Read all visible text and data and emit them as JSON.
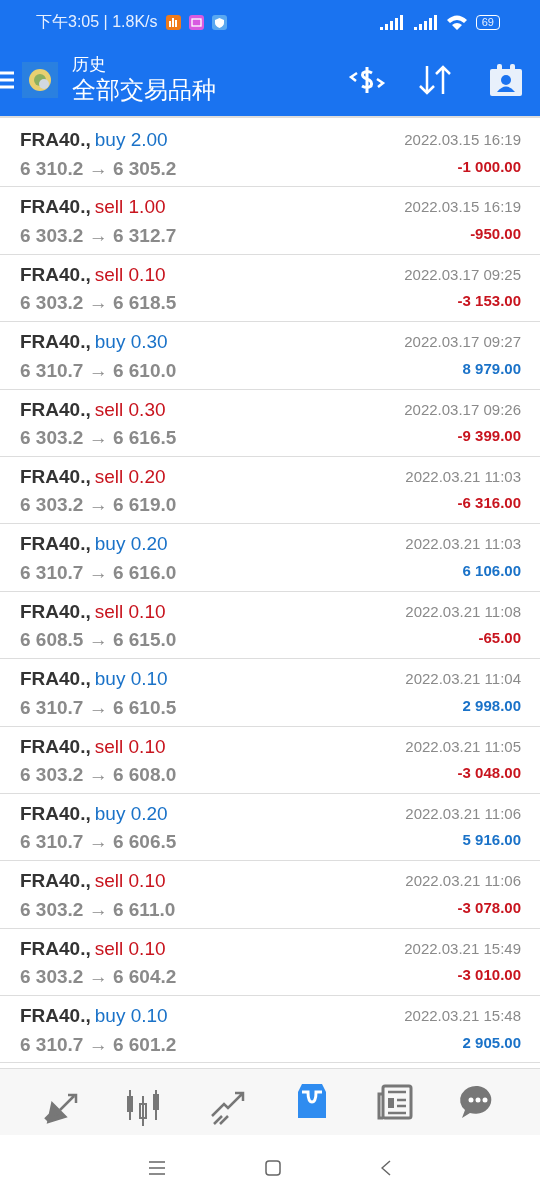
{
  "status_bar": {
    "time_speed": "下午3:05 | 1.8K/s",
    "battery": "69"
  },
  "header": {
    "subtitle": "历史",
    "title": "全部交易品种"
  },
  "trades": [
    {
      "symbol": "FRA40.,",
      "trade": "buy 2.00",
      "kind": "buy",
      "prices": "6 310.2 → 6 305.2",
      "time": "2022.03.15 16:19",
      "profit": "-1 000.00",
      "loss": true
    },
    {
      "symbol": "FRA40.,",
      "trade": "sell 1.00",
      "kind": "sell",
      "prices": "6 303.2 → 6 312.7",
      "time": "2022.03.15 16:19",
      "profit": "-950.00",
      "loss": true
    },
    {
      "symbol": "FRA40.,",
      "trade": "sell 0.10",
      "kind": "sell",
      "prices": "6 303.2 → 6 618.5",
      "time": "2022.03.17 09:25",
      "profit": "-3 153.00",
      "loss": true
    },
    {
      "symbol": "FRA40.,",
      "trade": "buy 0.30",
      "kind": "buy",
      "prices": "6 310.7 → 6 610.0",
      "time": "2022.03.17 09:27",
      "profit": "8 979.00",
      "loss": false
    },
    {
      "symbol": "FRA40.,",
      "trade": "sell 0.30",
      "kind": "sell",
      "prices": "6 303.2 → 6 616.5",
      "time": "2022.03.17 09:26",
      "profit": "-9 399.00",
      "loss": true
    },
    {
      "symbol": "FRA40.,",
      "trade": "sell 0.20",
      "kind": "sell",
      "prices": "6 303.2 → 6 619.0",
      "time": "2022.03.21 11:03",
      "profit": "-6 316.00",
      "loss": true
    },
    {
      "symbol": "FRA40.,",
      "trade": "buy 0.20",
      "kind": "buy",
      "prices": "6 310.7 → 6 616.0",
      "time": "2022.03.21 11:03",
      "profit": "6 106.00",
      "loss": false
    },
    {
      "symbol": "FRA40.,",
      "trade": "sell 0.10",
      "kind": "sell",
      "prices": "6 608.5 → 6 615.0",
      "time": "2022.03.21 11:08",
      "profit": "-65.00",
      "loss": true
    },
    {
      "symbol": "FRA40.,",
      "trade": "buy 0.10",
      "kind": "buy",
      "prices": "6 310.7 → 6 610.5",
      "time": "2022.03.21 11:04",
      "profit": "2 998.00",
      "loss": false
    },
    {
      "symbol": "FRA40.,",
      "trade": "sell 0.10",
      "kind": "sell",
      "prices": "6 303.2 → 6 608.0",
      "time": "2022.03.21 11:05",
      "profit": "-3 048.00",
      "loss": true
    },
    {
      "symbol": "FRA40.,",
      "trade": "buy 0.20",
      "kind": "buy",
      "prices": "6 310.7 → 6 606.5",
      "time": "2022.03.21 11:06",
      "profit": "5 916.00",
      "loss": false
    },
    {
      "symbol": "FRA40.,",
      "trade": "sell 0.10",
      "kind": "sell",
      "prices": "6 303.2 → 6 611.0",
      "time": "2022.03.21 11:06",
      "profit": "-3 078.00",
      "loss": true
    },
    {
      "symbol": "FRA40.,",
      "trade": "sell 0.10",
      "kind": "sell",
      "prices": "6 303.2 → 6 604.2",
      "time": "2022.03.21 15:49",
      "profit": "-3 010.00",
      "loss": true
    },
    {
      "symbol": "FRA40.,",
      "trade": "buy 0.10",
      "kind": "buy",
      "prices": "6 310.7 → 6 601.2",
      "time": "2022.03.21 15:48",
      "profit": "2 905.00",
      "loss": false
    }
  ],
  "bottom_nav": [
    {
      "kind": "quotes",
      "selected": false
    },
    {
      "kind": "chart",
      "selected": false
    },
    {
      "kind": "trade",
      "selected": false
    },
    {
      "kind": "history",
      "selected": true
    },
    {
      "kind": "news",
      "selected": false
    },
    {
      "kind": "chat",
      "selected": false
    }
  ]
}
